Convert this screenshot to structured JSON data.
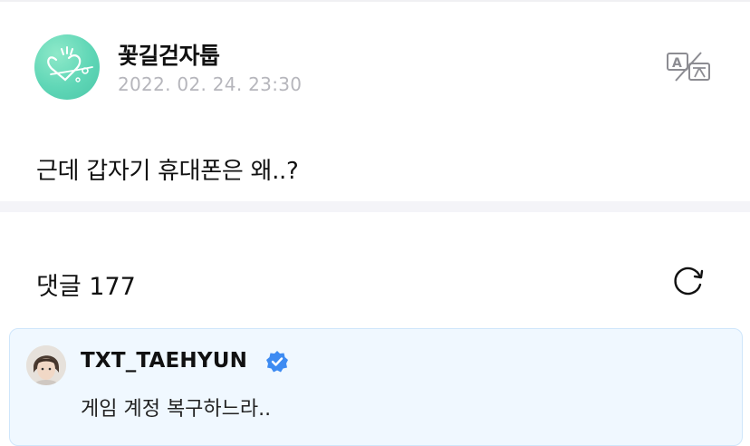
{
  "post": {
    "author": "꽃길걷자툽",
    "date": "2022. 02. 24. 23:30",
    "body": "근데 갑자기 휴대폰은 왜..?"
  },
  "comments": {
    "header": "댓글 177",
    "items": [
      {
        "username": "TXT_TAEHYUN",
        "verified": true,
        "text": "게임 계정 복구하느라.."
      }
    ]
  },
  "icons": {
    "translate": "translate-icon",
    "refresh": "refresh-icon",
    "verified": "verified-badge-icon"
  },
  "colors": {
    "avatar_green": "#5fd6b6",
    "date_gray": "#b6b6bc",
    "comment_bg": "#f0f8ff",
    "verified_blue": "#3d8bf2"
  }
}
